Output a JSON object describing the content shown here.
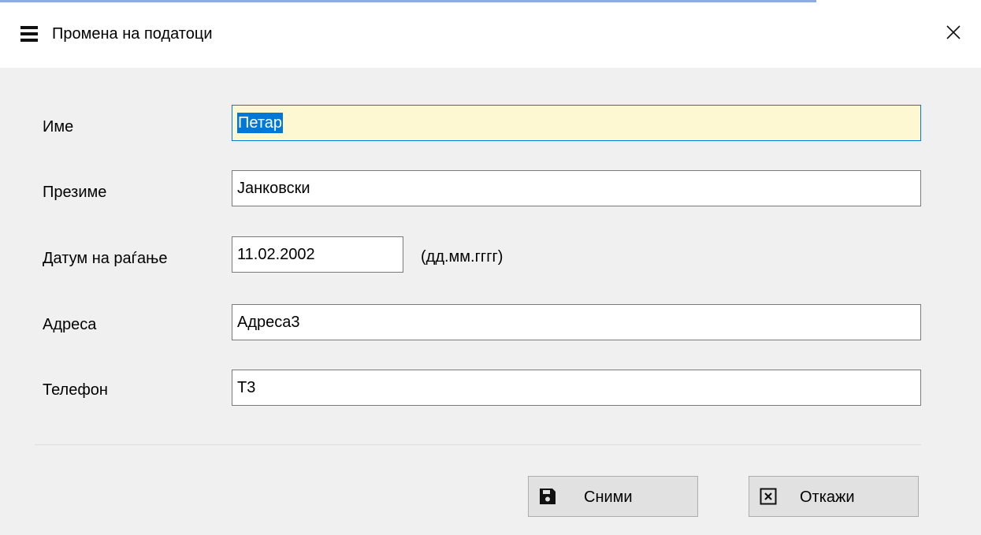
{
  "window": {
    "title": "Промена на податоци"
  },
  "form": {
    "first_name": {
      "label": "Име",
      "value": "Петар"
    },
    "last_name": {
      "label": "Презиме",
      "value": "Јанковски"
    },
    "birth_date": {
      "label": "Датум на раѓање",
      "value": "11.02.2002",
      "hint": "(дд.мм.гггг)"
    },
    "address": {
      "label": "Адреса",
      "value": "Адреса3"
    },
    "phone": {
      "label": "Телефон",
      "value": "Т3"
    }
  },
  "buttons": {
    "save_label": "Сними",
    "cancel_label": "Откажи"
  },
  "icons": {
    "title": "menu-icon",
    "close": "close-icon",
    "save": "floppy-disk-icon",
    "cancel": "close-box-icon"
  },
  "colors": {
    "selection": "#0078d7",
    "active_field_bg": "#fdf8d2",
    "window_bg": "#f0f0f0"
  }
}
